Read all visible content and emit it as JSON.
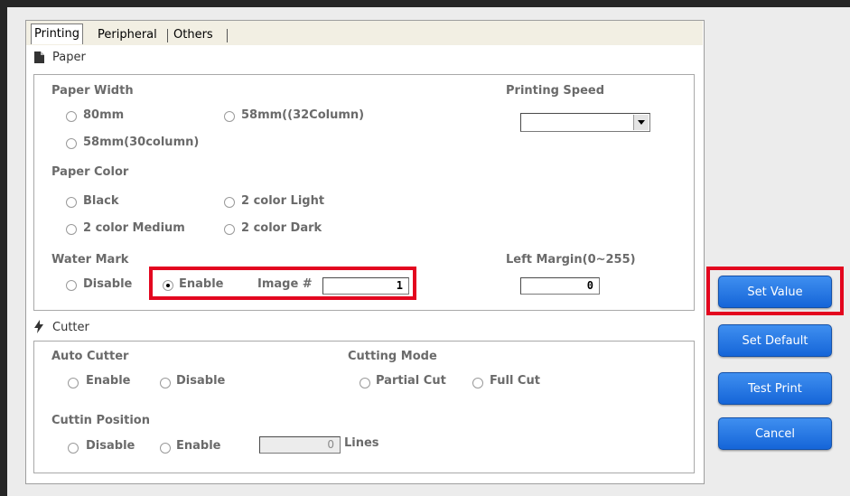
{
  "tabs": [
    {
      "label": "Printing"
    },
    {
      "label": "Peripheral"
    },
    {
      "label": "Others"
    }
  ],
  "paper": {
    "section_title": "Paper",
    "paper_width": {
      "label": "Paper Width",
      "options": [
        "80mm",
        "58mm((32Column)",
        "58mm(30column)"
      ]
    },
    "printing_speed": {
      "label": "Printing Speed",
      "value": ""
    },
    "paper_color": {
      "label": "Paper Color",
      "options": [
        "Black",
        "2 color Light",
        "2 color Medium",
        "2 color Dark"
      ]
    },
    "water_mark": {
      "label": "Water Mark",
      "options": [
        "Disable",
        "Enable"
      ],
      "selected": "Enable",
      "image_label": "Image #",
      "image_value": "1"
    },
    "left_margin": {
      "label": "Left Margin(0~255)",
      "value": "0"
    }
  },
  "cutter": {
    "section_title": "Cutter",
    "auto_cutter": {
      "label": "Auto Cutter",
      "options": [
        "Enable",
        "Disable"
      ]
    },
    "cutting_mode": {
      "label": "Cutting Mode",
      "options": [
        "Partial Cut",
        "Full Cut"
      ]
    },
    "cutting_position": {
      "label": "Cuttin Position",
      "options": [
        "Disable",
        "Enable"
      ],
      "value": "0",
      "unit": "Lines"
    }
  },
  "buttons": {
    "set_value": "Set Value",
    "set_default": "Set Default",
    "test_print": "Test Print",
    "cancel": "Cancel"
  },
  "colors": {
    "button_blue": "#1f6fe0",
    "highlight_red": "#e3061f"
  }
}
